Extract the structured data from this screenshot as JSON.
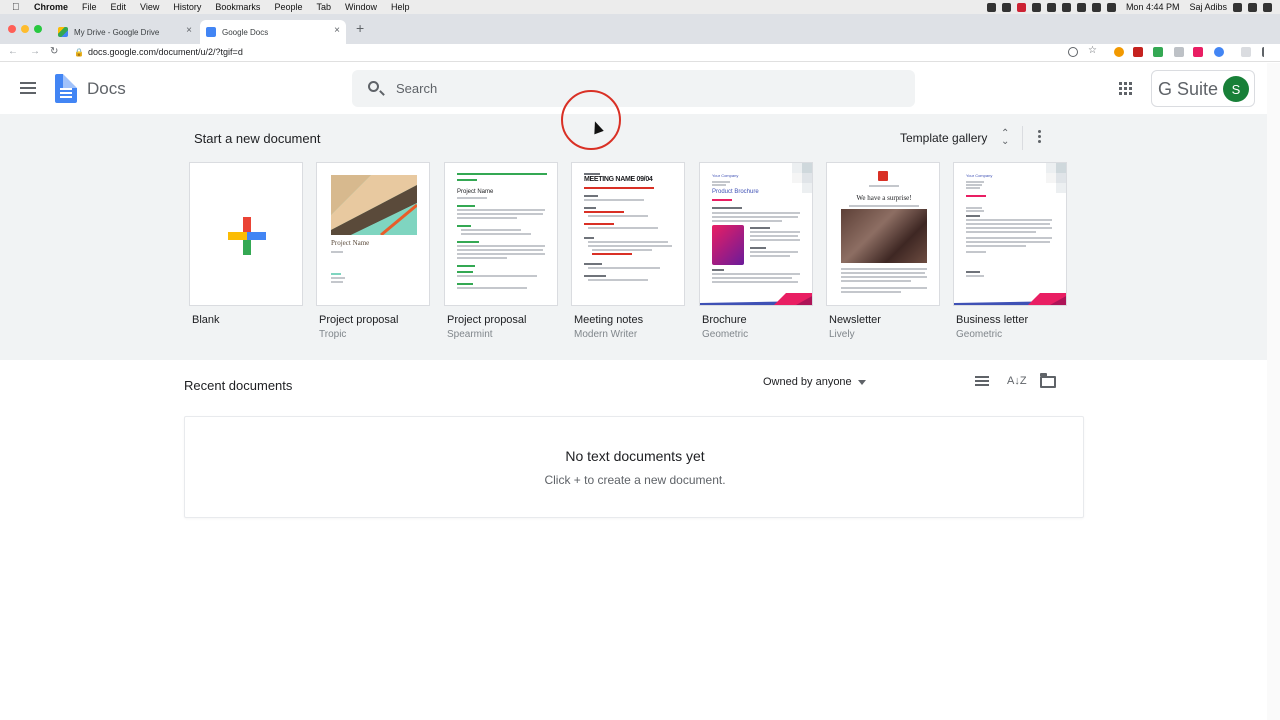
{
  "menubar": {
    "app": "Chrome",
    "items": [
      "File",
      "Edit",
      "View",
      "History",
      "Bookmarks",
      "People",
      "Tab",
      "Window",
      "Help"
    ],
    "clock": "Mon 4:44 PM",
    "user": "Saj Adibs"
  },
  "browser": {
    "tabs": [
      {
        "title": "My Drive - Google Drive",
        "icon": "drive-icon"
      },
      {
        "title": "Google Docs",
        "icon": "docs-icon"
      }
    ],
    "url": "docs.google.com/document/u/2/?tgif=d"
  },
  "header": {
    "app_name": "Docs",
    "search_placeholder": "Search",
    "gsuite_label": "G Suite",
    "avatar_initial": "S"
  },
  "templates": {
    "title": "Start a new document",
    "gallery_label": "Template gallery",
    "items": [
      {
        "name": "Blank",
        "sub": ""
      },
      {
        "name": "Project proposal",
        "sub": "Tropic",
        "thumb_title": "Project Name"
      },
      {
        "name": "Project proposal",
        "sub": "Spearmint",
        "thumb_title": "Project Name"
      },
      {
        "name": "Meeting notes",
        "sub": "Modern Writer",
        "thumb_title": "MEETING NAME 09/04"
      },
      {
        "name": "Brochure",
        "sub": "Geometric",
        "thumb_title": "Product Brochure",
        "thumb_company": "Your Company"
      },
      {
        "name": "Newsletter",
        "sub": "Lively",
        "thumb_title": "We have a surprise!"
      },
      {
        "name": "Business letter",
        "sub": "Geometric",
        "thumb_company": "Your Company"
      }
    ]
  },
  "recent": {
    "title": "Recent documents",
    "owner_filter": "Owned by anyone",
    "empty_title": "No text documents yet",
    "empty_sub": "Click + to create a new document."
  },
  "colors": {
    "google_blue": "#4285f4",
    "google_red": "#ea4335",
    "google_yellow": "#fbbc04",
    "google_green": "#34a853",
    "band_bg": "#f1f3f4"
  }
}
